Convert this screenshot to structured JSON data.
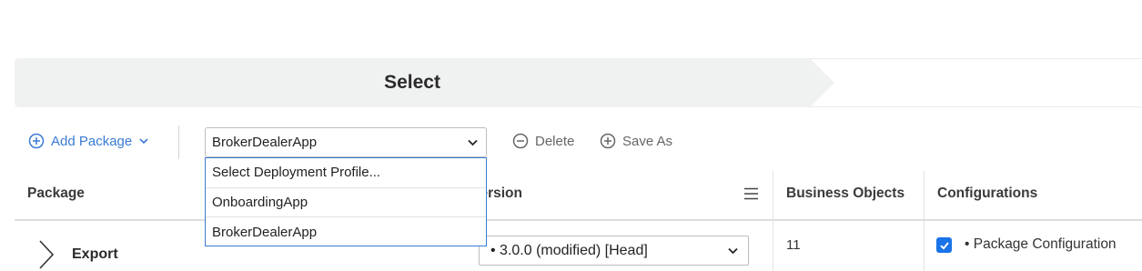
{
  "wizard": {
    "step_title": "Select"
  },
  "toolbar": {
    "add_package_label": "Add Package",
    "profile_selected": "BrokerDealerApp",
    "delete_label": "Delete",
    "save_as_label": "Save As"
  },
  "profile_dropdown": {
    "options": [
      "Select Deployment Profile...",
      "OnboardingApp",
      "BrokerDealerApp"
    ]
  },
  "table": {
    "headers": {
      "package": "Package",
      "version": "Version",
      "business_objects": "Business Objects",
      "configurations": "Configurations"
    },
    "rows": [
      {
        "package": "Export",
        "version": "• 3.0.0 (modified) [Head]",
        "business_objects": "11",
        "configuration_checked": true,
        "configuration": "• Package Configuration"
      }
    ]
  },
  "colors": {
    "accent": "#3b7bd4",
    "banner": "#f0f1f1",
    "checkbox": "#1a73e8"
  },
  "icons": {
    "add_package": "plus-circle-icon",
    "delete": "minus-circle-icon",
    "save_as": "plus-circle-icon",
    "column_menu": "hamburger-menu-icon",
    "expand_row": "chevron-right-icon"
  }
}
